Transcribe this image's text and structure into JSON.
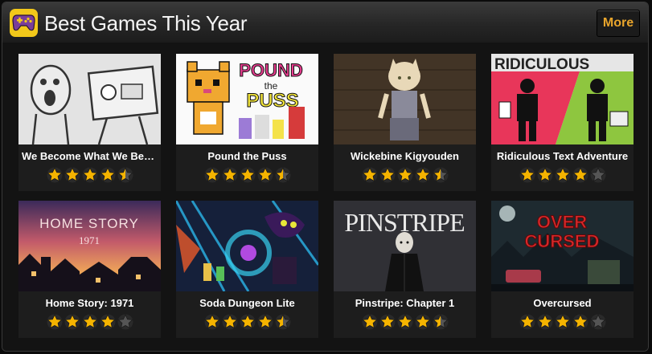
{
  "header": {
    "title": "Best Games This Year",
    "more_label": "More",
    "logo_icon": "gamepad-icon"
  },
  "colors": {
    "accent": "#e8a52c",
    "star": "#f5b400",
    "star_empty": "#555555"
  },
  "games": [
    {
      "title": "We Become What We Behold",
      "rating": 4.5,
      "thumb": "sketch"
    },
    {
      "title": "Pound the Puss",
      "rating": 4.5,
      "thumb": "pixel-cat"
    },
    {
      "title": "Wickebine Kigyouden",
      "rating": 4.5,
      "thumb": "anime"
    },
    {
      "title": "Ridiculous Text Adventure",
      "rating": 4,
      "thumb": "ridiculous"
    },
    {
      "title": "Home Story: 1971",
      "rating": 4,
      "thumb": "homestory"
    },
    {
      "title": "Soda Dungeon Lite",
      "rating": 4.5,
      "thumb": "soda"
    },
    {
      "title": "Pinstripe: Chapter 1",
      "rating": 4.5,
      "thumb": "pinstripe"
    },
    {
      "title": "Overcursed",
      "rating": 4,
      "thumb": "overcursed"
    }
  ],
  "thumb_text": {
    "pound_line1": "POUND",
    "pound_line2": "the",
    "pound_line3": "PUSS",
    "ridiculous": "RIDICULOUS",
    "home_story_line1": "HOME STORY",
    "home_story_line2": "1971",
    "pinstripe": "PINSTRIPE",
    "over_line1": "OVER",
    "over_line2": "CURSED"
  }
}
